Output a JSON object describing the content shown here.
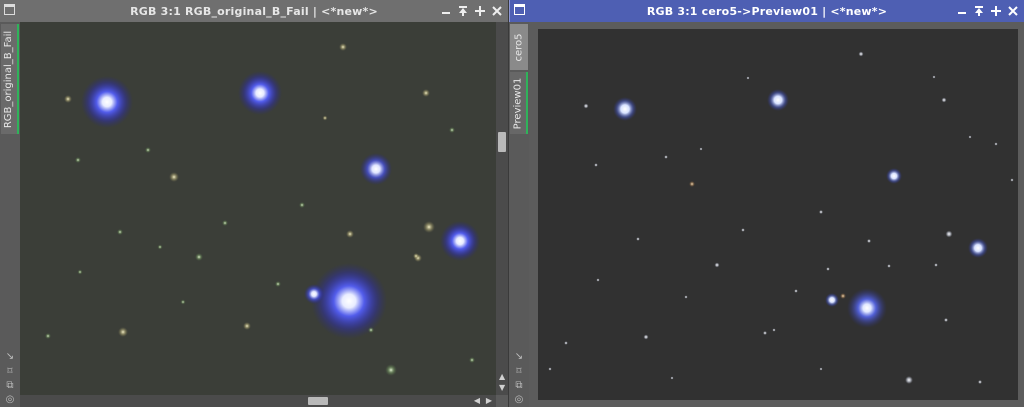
{
  "windows": {
    "left": {
      "title": "RGB 3:1 RGB_original_B_Fail | <*new*>",
      "tabs": [
        "RGB_original_B_Fail"
      ],
      "controls": [
        "minimize-icon",
        "shade-icon",
        "maximize-icon",
        "close-icon"
      ]
    },
    "right": {
      "title": "RGB 3:1 cero5->Preview01 | <*new*>",
      "tabs": [
        "cero5",
        "Preview01"
      ],
      "controls": [
        "minimize-icon",
        "shade-icon",
        "maximize-icon",
        "close-icon"
      ]
    }
  },
  "colors": {
    "active_title": "#4e5fb3",
    "inactive_title": "#6f6f6f",
    "tab_accent": "#2fb35a",
    "image_bg_left": "#3b3e38",
    "image_bg_right": "#313131"
  },
  "side_tools": [
    "move-icon",
    "zoom-fit-icon",
    "clone-icon",
    "target-icon"
  ]
}
